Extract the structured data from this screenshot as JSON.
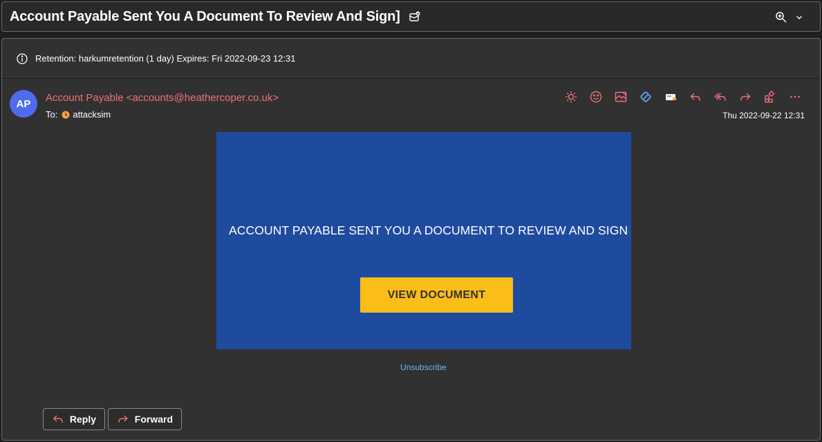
{
  "subject": {
    "title": "Account Payable Sent You A Document To Review And Sign]",
    "icon": "envelope-check-icon"
  },
  "subject_tools": {
    "zoom_icon": "zoom-icon",
    "expand_icon": "chevron-down-icon"
  },
  "retention": {
    "icon": "info-icon",
    "text": "Retention: harkumretention (1 day) Expires: Fri 2022-09-23 12:31"
  },
  "message": {
    "avatar_initials": "AP",
    "avatar_color": "#4f6bed",
    "sender": "Account Payable <accounts@heathercoper.co.uk>",
    "to_label": "To:",
    "recipient": "attacksim",
    "date": "Thu 2022-09-22 12:31",
    "accent_color": "#f1707b"
  },
  "actions": [
    {
      "name": "sun-icon"
    },
    {
      "name": "smiley-icon"
    },
    {
      "name": "image-icon"
    },
    {
      "name": "loop-icon"
    },
    {
      "name": "immersive-reader-icon"
    },
    {
      "name": "reply-icon"
    },
    {
      "name": "reply-all-icon"
    },
    {
      "name": "forward-icon"
    },
    {
      "name": "apps-icon"
    },
    {
      "name": "more-icon"
    }
  ],
  "email_body": {
    "banner_color": "#1f4b9f",
    "headline": "ACCOUNT PAYABLE SENT YOU A DOCUMENT TO REVIEW AND SIGN",
    "cta_label": "VIEW DOCUMENT",
    "cta_color": "#fbbd18",
    "unsubscribe": "Unsubscribe"
  },
  "reply_bar": {
    "reply_label": "Reply",
    "forward_label": "Forward"
  }
}
